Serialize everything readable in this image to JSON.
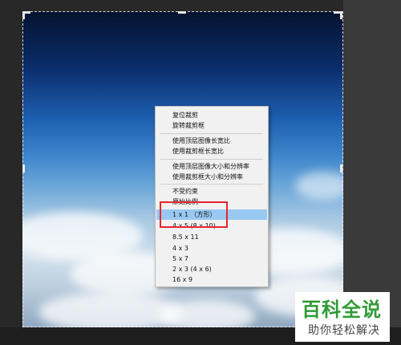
{
  "context_menu": {
    "items": [
      {
        "label": "复位裁剪"
      },
      {
        "label": "旋转裁剪框"
      },
      {
        "label": "使用顶层图像长宽比"
      },
      {
        "label": "使用裁剪框长宽比"
      },
      {
        "label": "使用顶层图像大小和分辨率"
      },
      {
        "label": "使用裁剪框大小和分辨率"
      },
      {
        "label": "不受约束"
      },
      {
        "label": "原始比例"
      },
      {
        "label": "1 x 1 （方形）"
      },
      {
        "label": "4 x 5 (8 x 10)"
      },
      {
        "label": "8.5 x 11"
      },
      {
        "label": "4 x 3"
      },
      {
        "label": "5 x 7"
      },
      {
        "label": "2 x 3 (4 x 6)"
      },
      {
        "label": "16 x 9"
      }
    ],
    "selected_label": "1 x 1 （方形）"
  },
  "watermark": {
    "title": "百科全说",
    "subtitle": "助你轻松解决"
  },
  "colors": {
    "selection": "#99c9f2",
    "highlight_box": "#e8262c",
    "watermark_green": "#2f9b35"
  }
}
